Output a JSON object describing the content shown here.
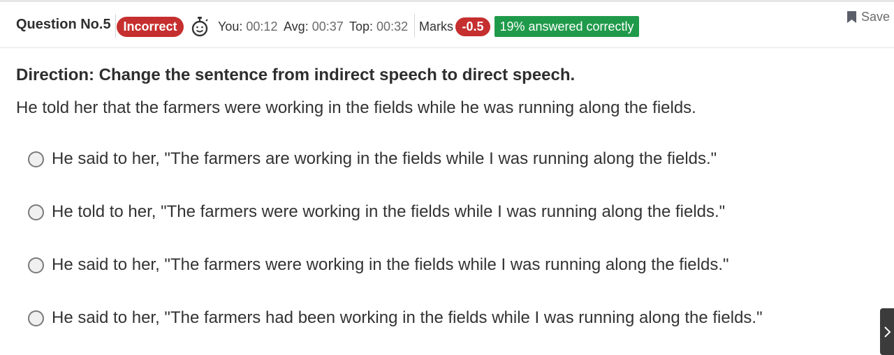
{
  "header": {
    "question_label": "Question No.5",
    "status": "Incorrect",
    "timers": [
      {
        "label": "You:",
        "value": "00:12"
      },
      {
        "label": "Avg:",
        "value": "00:37"
      },
      {
        "label": "Top:",
        "value": "00:32"
      }
    ],
    "marks_label": "Marks",
    "marks_value": "-0.5",
    "answered_badge": "19% answered correctly",
    "save_label": "Save",
    "icons": {
      "timer": "stopwatch-icon",
      "save": "bookmark-icon"
    }
  },
  "question": {
    "direction": "Direction: Change the sentence from indirect speech to direct speech.",
    "text": "He told her that the farmers were working in the fields while he was running along the fields.",
    "options": [
      "He said to her, \"The farmers are working in the fields while I was running along the fields.\"",
      "He told to her, \"The farmers were working in the fields while I was running along the fields.\"",
      "He said to her, \"The farmers were working in the fields while I was running along the fields.\"",
      "He said to her, \"The farmers had been working in the fields while I was running along the fields.\""
    ]
  },
  "next_icon": "chevron-right-icon",
  "colors": {
    "incorrect": "#c62f2f",
    "marks": "#c62f2f",
    "answered": "#1f9a4a"
  }
}
